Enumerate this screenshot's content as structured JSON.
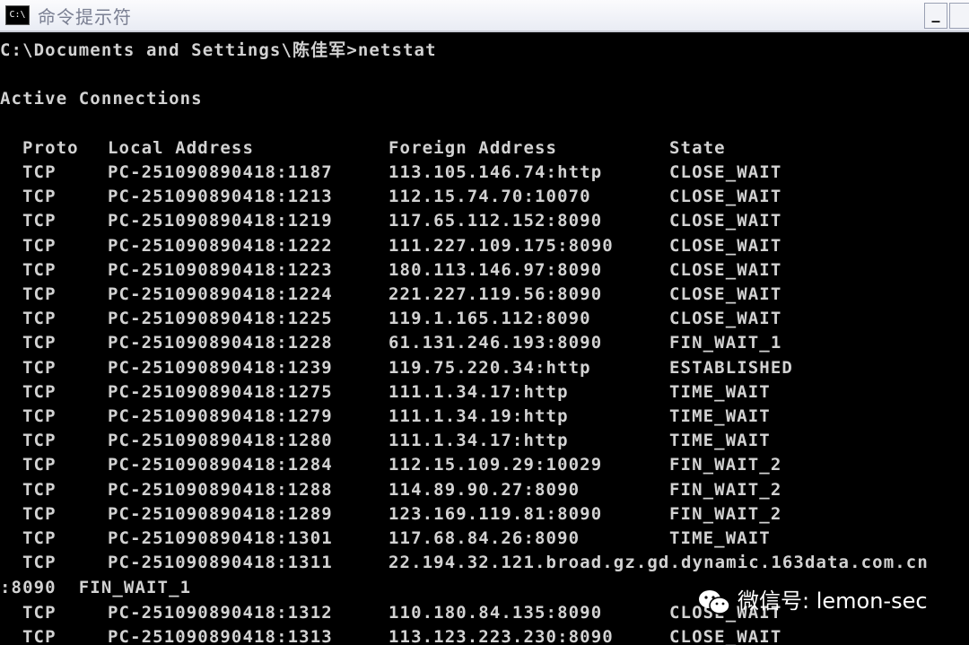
{
  "window": {
    "title": "命令提示符",
    "icon_text": "C:\\",
    "minimize_label": "_"
  },
  "console": {
    "command_line": "C:\\Documents and Settings\\陈佳军>netstat",
    "section_title": "Active Connections",
    "headers": [
      "Proto",
      "Local Address",
      "Foreign Address",
      "State"
    ],
    "rows": [
      [
        "TCP",
        "PC-251090890418:1187",
        "113.105.146.74:http",
        "CLOSE_WAIT"
      ],
      [
        "TCP",
        "PC-251090890418:1213",
        "112.15.74.70:10070",
        "CLOSE_WAIT"
      ],
      [
        "TCP",
        "PC-251090890418:1219",
        "117.65.112.152:8090",
        "CLOSE_WAIT"
      ],
      [
        "TCP",
        "PC-251090890418:1222",
        "111.227.109.175:8090",
        "CLOSE_WAIT"
      ],
      [
        "TCP",
        "PC-251090890418:1223",
        "180.113.146.97:8090",
        "CLOSE_WAIT"
      ],
      [
        "TCP",
        "PC-251090890418:1224",
        "221.227.119.56:8090",
        "CLOSE_WAIT"
      ],
      [
        "TCP",
        "PC-251090890418:1225",
        "119.1.165.112:8090",
        "CLOSE_WAIT"
      ],
      [
        "TCP",
        "PC-251090890418:1228",
        "61.131.246.193:8090",
        "FIN_WAIT_1"
      ],
      [
        "TCP",
        "PC-251090890418:1239",
        "119.75.220.34:http",
        "ESTABLISHED"
      ],
      [
        "TCP",
        "PC-251090890418:1275",
        "111.1.34.17:http",
        "TIME_WAIT"
      ],
      [
        "TCP",
        "PC-251090890418:1279",
        "111.1.34.19:http",
        "TIME_WAIT"
      ],
      [
        "TCP",
        "PC-251090890418:1280",
        "111.1.34.17:http",
        "TIME_WAIT"
      ],
      [
        "TCP",
        "PC-251090890418:1284",
        "112.15.109.29:10029",
        "FIN_WAIT_2"
      ],
      [
        "TCP",
        "PC-251090890418:1288",
        "114.89.90.27:8090",
        "FIN_WAIT_2"
      ],
      [
        "TCP",
        "PC-251090890418:1289",
        "123.169.119.81:8090",
        "FIN_WAIT_2"
      ],
      [
        "TCP",
        "PC-251090890418:1301",
        "117.68.84.26:8090",
        "TIME_WAIT"
      ],
      [
        "TCP",
        "PC-251090890418:1311",
        "22.194.32.121.broad.gz.gd.dynamic.163data.com.cn",
        ""
      ]
    ],
    "wrap_line": ":8090  FIN_WAIT_1",
    "rows_after_wrap": [
      [
        "TCP",
        "PC-251090890418:1312",
        "110.180.84.135:8090",
        "CLOSE_WAIT"
      ],
      [
        "TCP",
        "PC-251090890418:1313",
        "113.123.223.230:8090",
        "CLOSE_WAIT"
      ]
    ]
  },
  "watermark": {
    "text": "微信号: lemon-sec"
  }
}
